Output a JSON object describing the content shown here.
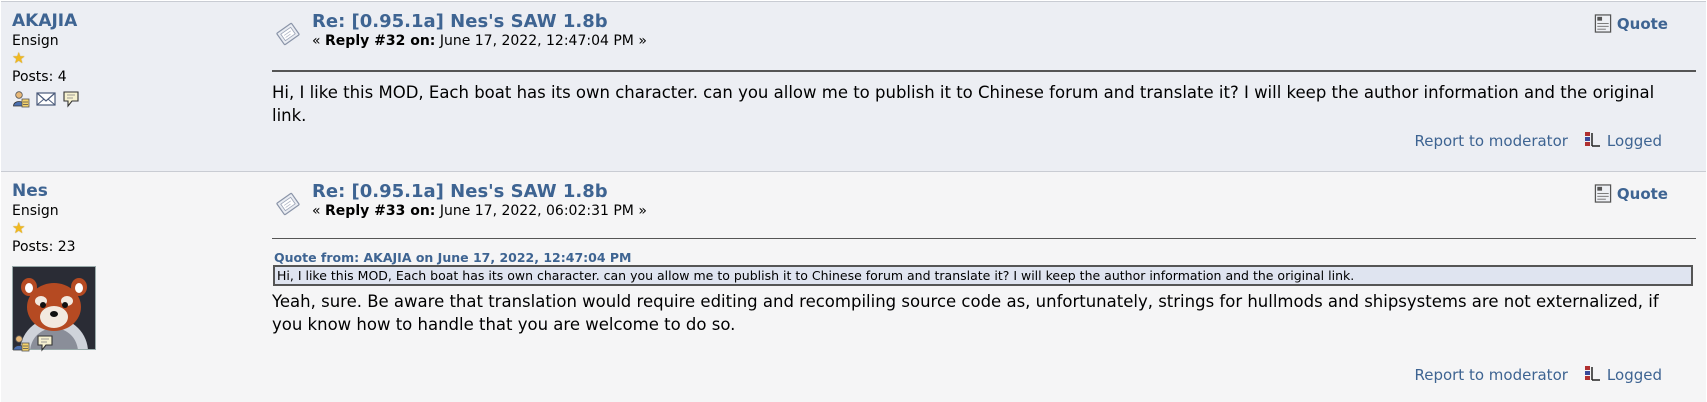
{
  "posts": [
    {
      "author": "AKAJIA",
      "rank": "Ensign",
      "star_glyph": "★",
      "posts": "Posts: 4",
      "subject": "Re: [0.95.1a] Nes's SAW 1.8b",
      "reply_prefix": "« ",
      "reply_label": "Reply #32 on:",
      "reply_date": " June 17, 2022, 12:47:04 PM »",
      "quote_label": "Quote",
      "body": "Hi, I like this MOD, Each boat has its own character. can you allow me to publish it to Chinese forum and translate it? I will keep the author information and the original link.",
      "report_label": "Report to moderator",
      "logged_label": "Logged",
      "profile_icons": [
        "profile-icon",
        "email-icon",
        "pm-icon"
      ]
    },
    {
      "author": "Nes",
      "rank": "Ensign",
      "star_glyph": "★",
      "posts": "Posts: 23",
      "avatar": "red-panda-astronaut-avatar",
      "subject": "Re: [0.95.1a] Nes's SAW 1.8b",
      "reply_prefix": "« ",
      "reply_label": "Reply #33 on:",
      "reply_date": " June 17, 2022, 06:02:31 PM »",
      "quote_label": "Quote",
      "quote_header": "Quote from: AKAJIA on June 17, 2022, 12:47:04 PM",
      "quote_text": "Hi, I like this MOD, Each boat has its own character. can you allow me to publish it to Chinese forum and translate it? I will keep the author information and the original link.",
      "body": "Yeah, sure. Be aware that translation would require editing and recompiling source code as, unfortunately, strings for hullmods and shipsystems are not externalized, if you know how to handle that you are welcome to do so.",
      "report_label": "Report to moderator",
      "logged_label": "Logged",
      "profile_icons": [
        "profile-icon",
        "pm-icon"
      ]
    }
  ],
  "colors": {
    "link": "#3e6492",
    "row1_bg": "#eceef3",
    "row2_bg": "#f5f5f6",
    "quote_bg": "#dfe4f0"
  }
}
